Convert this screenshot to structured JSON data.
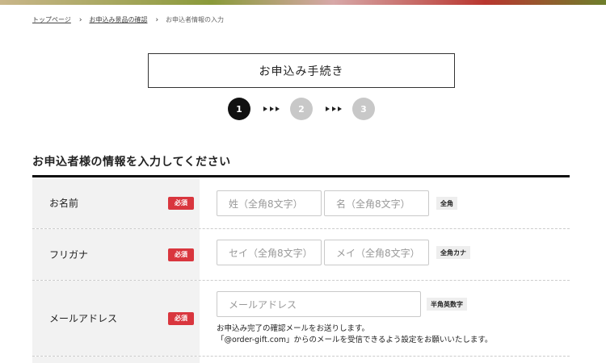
{
  "breadcrumb": {
    "top": "トップページ",
    "confirm": "お申込み景品の確認",
    "current": "お申込者情報の入力"
  },
  "procedure": {
    "title": "お申込み手続き"
  },
  "steps": {
    "step1": "1",
    "step2": "2",
    "step3": "3",
    "current": 1
  },
  "section": {
    "title": "お申込者様の情報を入力してください"
  },
  "required_label": "必須",
  "form": {
    "name": {
      "label": "お名前",
      "last_placeholder": "姓（全角8文字）",
      "first_placeholder": "名（全角8文字）",
      "tag": "全角"
    },
    "kana": {
      "label": "フリガナ",
      "last_placeholder": "セイ（全角8文字）",
      "first_placeholder": "メイ（全角8文字）",
      "tag": "全角カナ"
    },
    "email": {
      "label": "メールアドレス",
      "placeholder": "メールアドレス",
      "tag": "半角英数字",
      "note_line1": "お申込み完了の確認メールをお送りします。",
      "note_line2": "「@order-gift.com」からのメールを受信できるよう設定をお願いいたします。"
    }
  }
}
